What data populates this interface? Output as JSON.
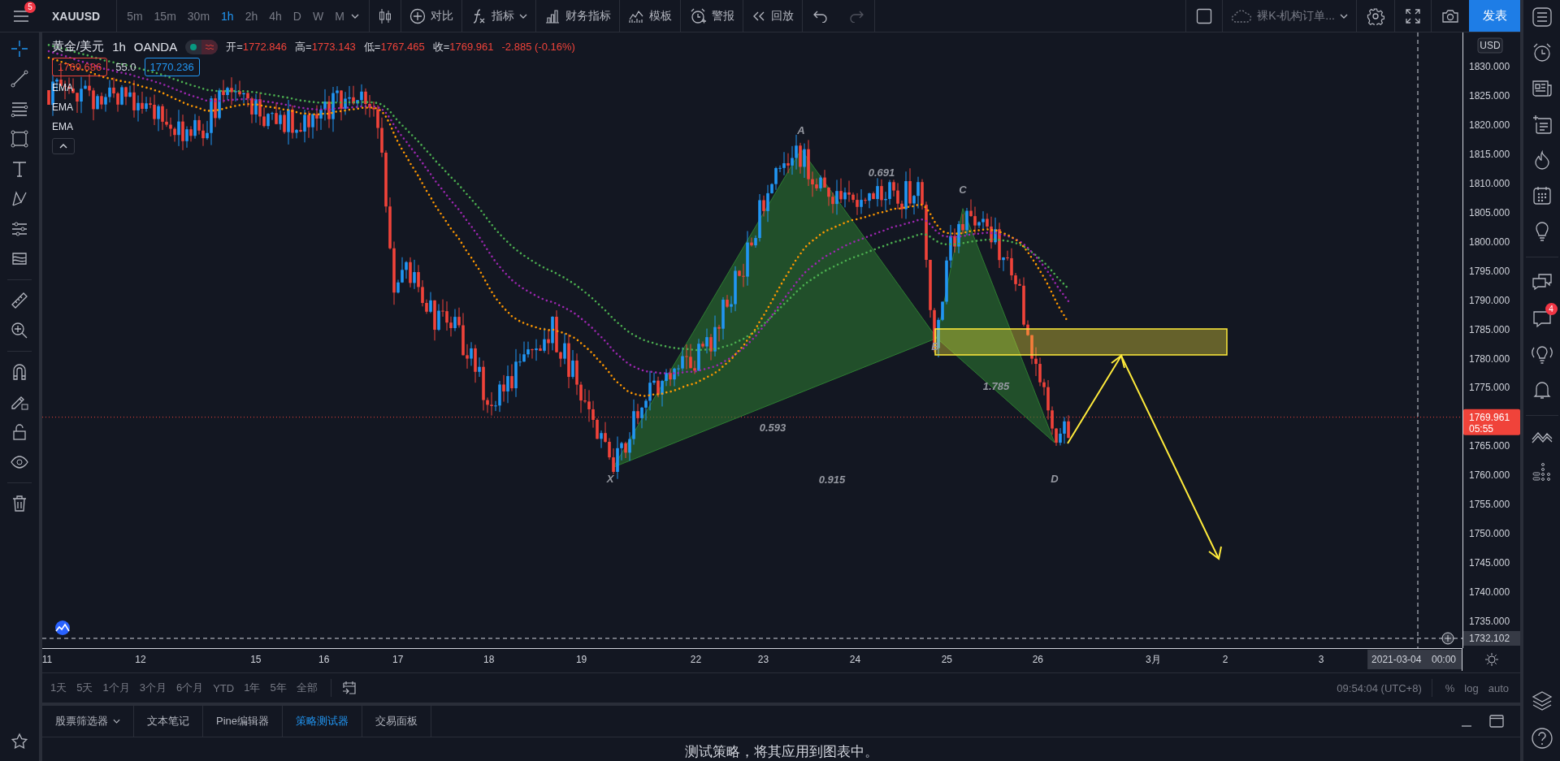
{
  "top_bar": {
    "notification_count": "5",
    "symbol": "XAUUSD",
    "intervals": [
      {
        "label": "5m",
        "selected": false
      },
      {
        "label": "15m",
        "selected": false
      },
      {
        "label": "30m",
        "selected": false
      },
      {
        "label": "1h",
        "selected": true
      },
      {
        "label": "2h",
        "selected": false
      },
      {
        "label": "4h",
        "selected": false
      },
      {
        "label": "D",
        "selected": false
      },
      {
        "label": "W",
        "selected": false
      },
      {
        "label": "M",
        "selected": false
      }
    ],
    "tools": [
      {
        "kind": "chart_type"
      },
      {
        "kind": "compare",
        "label": "对比"
      },
      {
        "kind": "indicators",
        "label": "指标"
      },
      {
        "kind": "financials",
        "label": "财务指标"
      },
      {
        "kind": "templates",
        "label": "模板"
      },
      {
        "kind": "alert",
        "label": "警报"
      },
      {
        "kind": "replay",
        "label": "回放"
      }
    ],
    "layout_name": "裸K-机构订单...",
    "publish_button": "发表"
  },
  "legend": {
    "symbol_name": "黄金/美元",
    "interval": "1h",
    "exchange": "OANDA",
    "status_on": true,
    "ohlc": [
      {
        "label": "开=",
        "value": "1772.846"
      },
      {
        "label": "高=",
        "value": "1773.143"
      },
      {
        "label": "低=",
        "value": "1767.465"
      },
      {
        "label": "收=",
        "value": "1769.961"
      }
    ],
    "change": "-2.885 (-0.16%)",
    "bid": "1769.686",
    "spread": "55.0",
    "ask": "1770.236",
    "indicators": [
      "EMA",
      "EMA",
      "EMA"
    ]
  },
  "pattern": {
    "points": [
      "X",
      "A",
      "B",
      "C",
      "D"
    ],
    "ratios": [
      "0.691",
      "0.593",
      "1.785",
      "0.915"
    ]
  },
  "price_axis": {
    "currency": "USD",
    "labels": [
      "1830.000",
      "1825.000",
      "1820.000",
      "1815.000",
      "1810.000",
      "1805.000",
      "1800.000",
      "1795.000",
      "1790.000",
      "1785.000",
      "1780.000",
      "1775.000",
      "1765.000",
      "1760.000",
      "1755.000",
      "1750.000",
      "1745.000",
      "1740.000",
      "1735.000"
    ],
    "last_price": "1769.961",
    "countdown": "05:55",
    "crosshair_price": "1732.102"
  },
  "time_axis": {
    "labels": [
      "11",
      "12",
      "15",
      "16",
      "17",
      "18",
      "19",
      "22",
      "23",
      "24",
      "25",
      "26",
      "3月",
      "2",
      "3"
    ],
    "crosshair_date": "2021-03-04",
    "crosshair_time": "00:00"
  },
  "right_sidebar": {
    "chat_badge": "4"
  },
  "range_bar": {
    "ranges": [
      "1天",
      "5天",
      "1个月",
      "3个月",
      "6个月",
      "YTD",
      "1年",
      "5年",
      "全部"
    ],
    "clock": "09:54:04 (UTC+8)",
    "scale_options": [
      "%",
      "log",
      "auto"
    ]
  },
  "bottom_panel": {
    "tabs": [
      {
        "label": "股票筛选器",
        "selected": false
      },
      {
        "label": "文本笔记",
        "selected": false
      },
      {
        "label": "Pine编辑器",
        "selected": false
      },
      {
        "label": "策略测试器",
        "selected": true
      },
      {
        "label": "交易面板",
        "selected": false
      }
    ],
    "message": "测试策略，将其应用到图表中。"
  }
}
